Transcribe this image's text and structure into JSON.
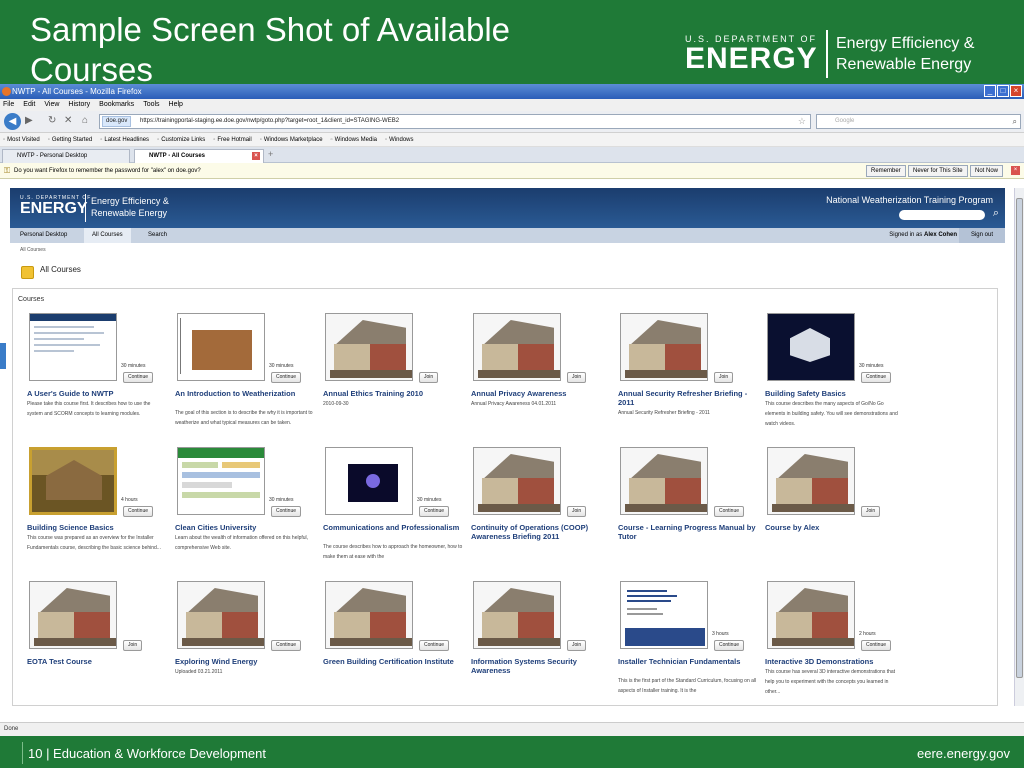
{
  "slide": {
    "title": "Sample Screen Shot of Available Courses",
    "logo_small": "U.S. DEPARTMENT OF",
    "logo_big": "ENERGY",
    "logo_line1": "Energy Efficiency &",
    "logo_line2": "Renewable Energy",
    "footer_left": "10 | Education & Workforce Development",
    "footer_right": "eere.energy.gov"
  },
  "browser": {
    "window_title": "NWTP - All Courses - Mozilla Firefox",
    "menu": [
      "File",
      "Edit",
      "View",
      "History",
      "Bookmarks",
      "Tools",
      "Help"
    ],
    "site_identity": "doe.gov",
    "url": "https://trainingportal-staging.ee.doe.gov/nwtp/goto.php?target=root_1&client_id=STAGING-WEB2",
    "search_placeholder": "Google",
    "bookmarks": [
      "Most Visited",
      "Getting Started",
      "Latest Headlines",
      "Customize Links",
      "Free Hotmail",
      "Windows Marketplace",
      "Windows Media",
      "Windows"
    ],
    "tabs": [
      {
        "label": "NWTP - Personal Desktop",
        "active": false
      },
      {
        "label": "NWTP - All Courses",
        "active": true
      }
    ],
    "notification": "Do you want Firefox to remember the password for \"alex\" on doe.gov?",
    "notif_buttons": [
      "Remember",
      "Never for This Site",
      "Not Now"
    ],
    "status": "Done"
  },
  "site": {
    "logo_small": "U.S. DEPARTMENT OF",
    "logo_big": "ENERGY",
    "logo_line1": "Energy Efficiency &",
    "logo_line2": "Renewable Energy",
    "program": "National Weatherization Training Program",
    "nav": [
      "Personal Desktop",
      "All Courses",
      "Search"
    ],
    "signed_in_prefix": "Signed in as",
    "signed_in_user": "Alex Cohen",
    "sign_out": "Sign out",
    "breadcrumb": "All Courses",
    "page_title": "All Courses",
    "panel_label": "Courses"
  },
  "courses": [
    {
      "title": "A User's Guide to NWTP",
      "meta": "30 minutes",
      "button": "Continue",
      "desc": "Please take this course first. It describes how to use the system and SCORM concepts to learning modules."
    },
    {
      "title": "An Introduction to Weatherization",
      "meta": "30 minutes",
      "button": "Continue",
      "desc": "The goal of this section is to describe the why it is important to weatherize and what typical measures can be taken."
    },
    {
      "title": "Annual Ethics Training 2010",
      "meta": "",
      "button": "Join",
      "desc": "2010-09-30"
    },
    {
      "title": "Annual Privacy Awareness",
      "meta": "",
      "button": "Join",
      "desc": "Annual Privacy Awareness 04.01.2011"
    },
    {
      "title": "Annual Security Refresher Briefing - 2011",
      "meta": "",
      "button": "Join",
      "desc": "Annual Security Refresher Briefing - 2011"
    },
    {
      "title": "Building Safety Basics",
      "meta": "30 minutes",
      "button": "Continue",
      "desc": "This course describes the many aspects of Go/No Go elements in building safety. You will see demonstrations and watch videos."
    },
    {
      "title": "Building Science Basics",
      "meta": "4 hours",
      "button": "Continue",
      "desc": "This course was prepared as an overview for the Installer Fundamentals course, describing the basic science behind..."
    },
    {
      "title": "Clean Cities University",
      "meta": "30 minutes",
      "button": "Continue",
      "desc": "Learn about the wealth of information offered on this helpful, comprehensive Web site."
    },
    {
      "title": "Communications and Professionalism",
      "meta": "30 minutes",
      "button": "Continue",
      "desc": "The course describes how to approach the homeowner, how to make them at ease with the"
    },
    {
      "title": "Continuity of Operations (COOP) Awareness Briefing 2011",
      "meta": "",
      "button": "Join",
      "desc": ""
    },
    {
      "title": "Course - Learning Progress Manual by Tutor",
      "meta": "",
      "button": "Continue",
      "desc": ""
    },
    {
      "title": "Course by Alex",
      "meta": "",
      "button": "Join",
      "desc": ""
    },
    {
      "title": "EOTA Test Course",
      "meta": "",
      "button": "Join",
      "desc": ""
    },
    {
      "title": "Exploring Wind Energy",
      "meta": "",
      "button": "Continue",
      "desc": "Uploaded 03.21.2011"
    },
    {
      "title": "Green Building Certification Institute",
      "meta": "",
      "button": "Continue",
      "desc": ""
    },
    {
      "title": "Information Systems Security Awareness",
      "meta": "",
      "button": "Join",
      "desc": ""
    },
    {
      "title": "Installer Technician Fundamentals",
      "meta": "3 hours",
      "button": "Continue",
      "desc": "This is the first part of the Standard Curriculum, focusing on all aspects of Installer training. It is the"
    },
    {
      "title": "Interactive 3D Demonstrations",
      "meta": "2 hours",
      "button": "Continue",
      "desc": "This course has several 3D interactive demonstrations that help you to experiment with the concepts you learned in other..."
    }
  ]
}
